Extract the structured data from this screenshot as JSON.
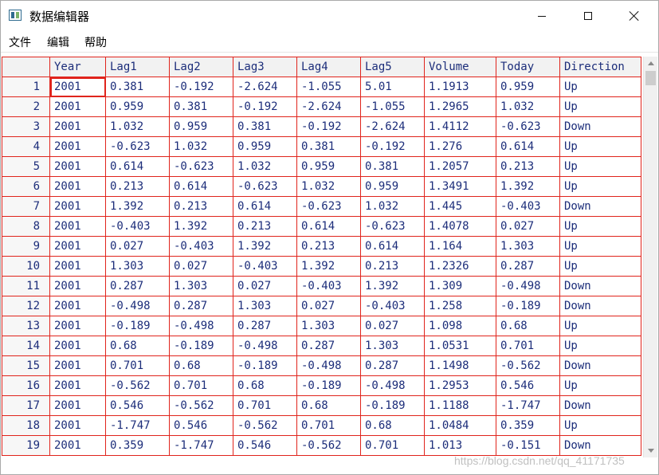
{
  "window": {
    "title": "数据编辑器",
    "icon": "app-grid-icon"
  },
  "menu": [
    "文件",
    "编辑",
    "帮助"
  ],
  "grid": {
    "columns": [
      "Year",
      "Lag1",
      "Lag2",
      "Lag3",
      "Lag4",
      "Lag5",
      "Volume",
      "Today",
      "Direction"
    ],
    "rows": [
      {
        "row": "1",
        "cells": [
          "2001",
          "0.381",
          "-0.192",
          "-2.624",
          "-1.055",
          "5.01",
          "1.1913",
          "0.959",
          "Up"
        ]
      },
      {
        "row": "2",
        "cells": [
          "2001",
          "0.959",
          "0.381",
          "-0.192",
          "-2.624",
          "-1.055",
          "1.2965",
          "1.032",
          "Up"
        ]
      },
      {
        "row": "3",
        "cells": [
          "2001",
          "1.032",
          "0.959",
          "0.381",
          "-0.192",
          "-2.624",
          "1.4112",
          "-0.623",
          "Down"
        ]
      },
      {
        "row": "4",
        "cells": [
          "2001",
          "-0.623",
          "1.032",
          "0.959",
          "0.381",
          "-0.192",
          "1.276",
          "0.614",
          "Up"
        ]
      },
      {
        "row": "5",
        "cells": [
          "2001",
          "0.614",
          "-0.623",
          "1.032",
          "0.959",
          "0.381",
          "1.2057",
          "0.213",
          "Up"
        ]
      },
      {
        "row": "6",
        "cells": [
          "2001",
          "0.213",
          "0.614",
          "-0.623",
          "1.032",
          "0.959",
          "1.3491",
          "1.392",
          "Up"
        ]
      },
      {
        "row": "7",
        "cells": [
          "2001",
          "1.392",
          "0.213",
          "0.614",
          "-0.623",
          "1.032",
          "1.445",
          "-0.403",
          "Down"
        ]
      },
      {
        "row": "8",
        "cells": [
          "2001",
          "-0.403",
          "1.392",
          "0.213",
          "0.614",
          "-0.623",
          "1.4078",
          "0.027",
          "Up"
        ]
      },
      {
        "row": "9",
        "cells": [
          "2001",
          "0.027",
          "-0.403",
          "1.392",
          "0.213",
          "0.614",
          "1.164",
          "1.303",
          "Up"
        ]
      },
      {
        "row": "10",
        "cells": [
          "2001",
          "1.303",
          "0.027",
          "-0.403",
          "1.392",
          "0.213",
          "1.2326",
          "0.287",
          "Up"
        ]
      },
      {
        "row": "11",
        "cells": [
          "2001",
          "0.287",
          "1.303",
          "0.027",
          "-0.403",
          "1.392",
          "1.309",
          "-0.498",
          "Down"
        ]
      },
      {
        "row": "12",
        "cells": [
          "2001",
          "-0.498",
          "0.287",
          "1.303",
          "0.027",
          "-0.403",
          "1.258",
          "-0.189",
          "Down"
        ]
      },
      {
        "row": "13",
        "cells": [
          "2001",
          "-0.189",
          "-0.498",
          "0.287",
          "1.303",
          "0.027",
          "1.098",
          "0.68",
          "Up"
        ]
      },
      {
        "row": "14",
        "cells": [
          "2001",
          "0.68",
          "-0.189",
          "-0.498",
          "0.287",
          "1.303",
          "1.0531",
          "0.701",
          "Up"
        ]
      },
      {
        "row": "15",
        "cells": [
          "2001",
          "0.701",
          "0.68",
          "-0.189",
          "-0.498",
          "0.287",
          "1.1498",
          "-0.562",
          "Down"
        ]
      },
      {
        "row": "16",
        "cells": [
          "2001",
          "-0.562",
          "0.701",
          "0.68",
          "-0.189",
          "-0.498",
          "1.2953",
          "0.546",
          "Up"
        ]
      },
      {
        "row": "17",
        "cells": [
          "2001",
          "0.546",
          "-0.562",
          "0.701",
          "0.68",
          "-0.189",
          "1.1188",
          "-1.747",
          "Down"
        ]
      },
      {
        "row": "18",
        "cells": [
          "2001",
          "-1.747",
          "0.546",
          "-0.562",
          "0.701",
          "0.68",
          "1.0484",
          "0.359",
          "Up"
        ]
      },
      {
        "row": "19",
        "cells": [
          "2001",
          "0.359",
          "-1.747",
          "0.546",
          "-0.562",
          "0.701",
          "1.013",
          "-0.151",
          "Down"
        ]
      }
    ]
  },
  "watermark": "https://blog.csdn.net/qq_41171735",
  "colors": {
    "grid_line": "#e0241c",
    "cell_text": "#1c2d7a"
  }
}
